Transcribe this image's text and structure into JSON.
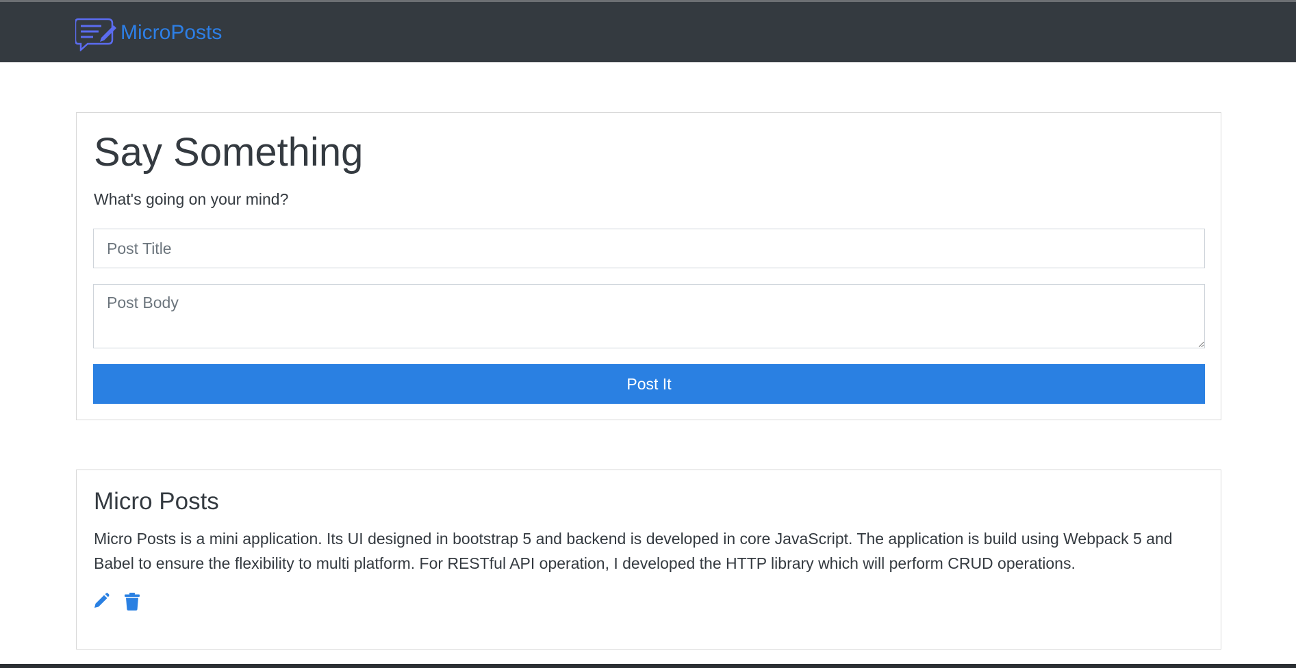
{
  "navbar": {
    "brand_text": "MicroPosts",
    "logo_icon": "chat-pencil-icon",
    "background": "#343a40",
    "brand_color": "#2d7fe6"
  },
  "form": {
    "title": "Say Something",
    "subtitle": "What's going on your mind?",
    "title_placeholder": "Post Title",
    "title_value": "",
    "body_placeholder": "Post Body",
    "body_value": "",
    "submit_label": "Post It",
    "button_color": "#2a80e2"
  },
  "posts": [
    {
      "title": "Micro Posts",
      "body": "Micro Posts is a mini application. Its UI designed in bootstrap 5 and backend is developed in core JavaScript. The application is build using Webpack 5 and Babel to ensure the flexibility to multi platform. For RESTful API operation, I developed the HTTP library which will perform CRUD operations.",
      "edit_icon": "pencil-icon",
      "delete_icon": "trash-icon"
    }
  ]
}
